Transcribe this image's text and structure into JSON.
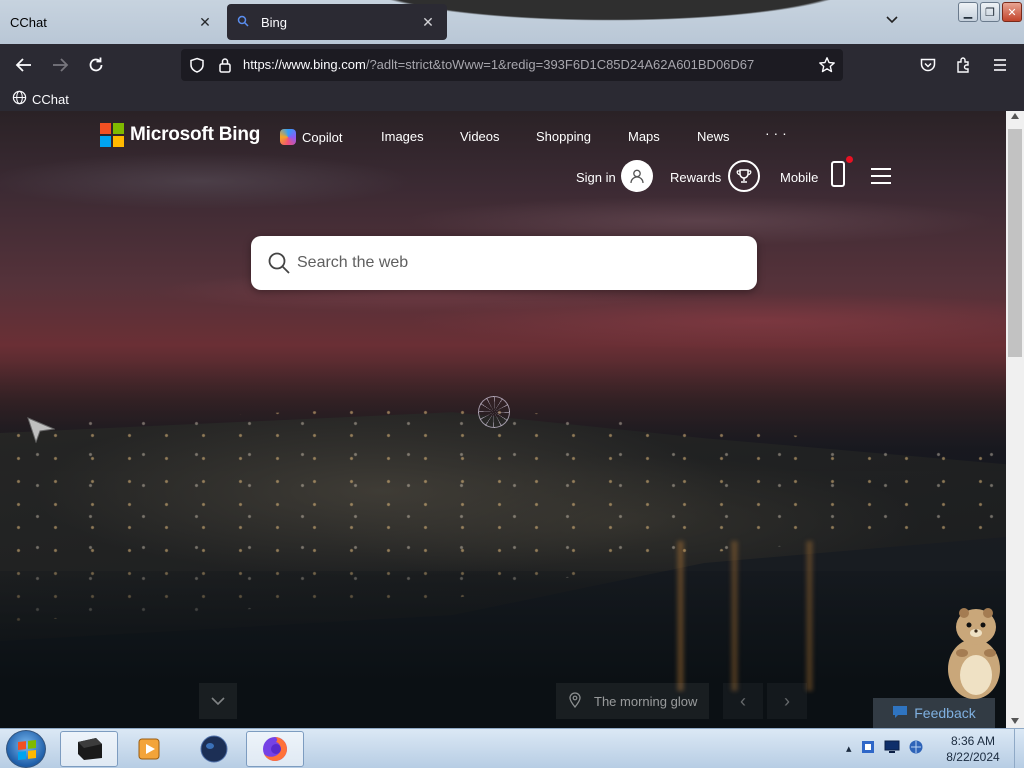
{
  "browser": {
    "tabs": [
      {
        "title": "CChat",
        "active": false
      },
      {
        "title": "Bing",
        "active": true
      }
    ],
    "url": {
      "host": "https://www.bing.com",
      "rest": "/?adlt=strict&toWww=1&redig=393F6D1C85D24A62A601BD06D67"
    },
    "bookmarks": [
      {
        "label": "CChat"
      }
    ]
  },
  "bing": {
    "logo_text": "Microsoft Bing",
    "nav": [
      "Copilot",
      "Images",
      "Videos",
      "Shopping",
      "Maps",
      "News",
      "· · ·"
    ],
    "sign_in_label": "Sign in",
    "rewards_label": "Rewards",
    "mobile_label": "Mobile",
    "search_placeholder": "Search the web",
    "image_caption": "The morning glow",
    "feedback_label": "Feedback"
  },
  "taskbar": {
    "time": "8:36 AM",
    "date": "8/22/2024"
  },
  "colors": {
    "ms_red": "#f25022",
    "ms_green": "#7fba00",
    "ms_blue": "#00a4ef",
    "ms_yellow": "#ffb900",
    "browser_dark": "#2b2a33"
  }
}
